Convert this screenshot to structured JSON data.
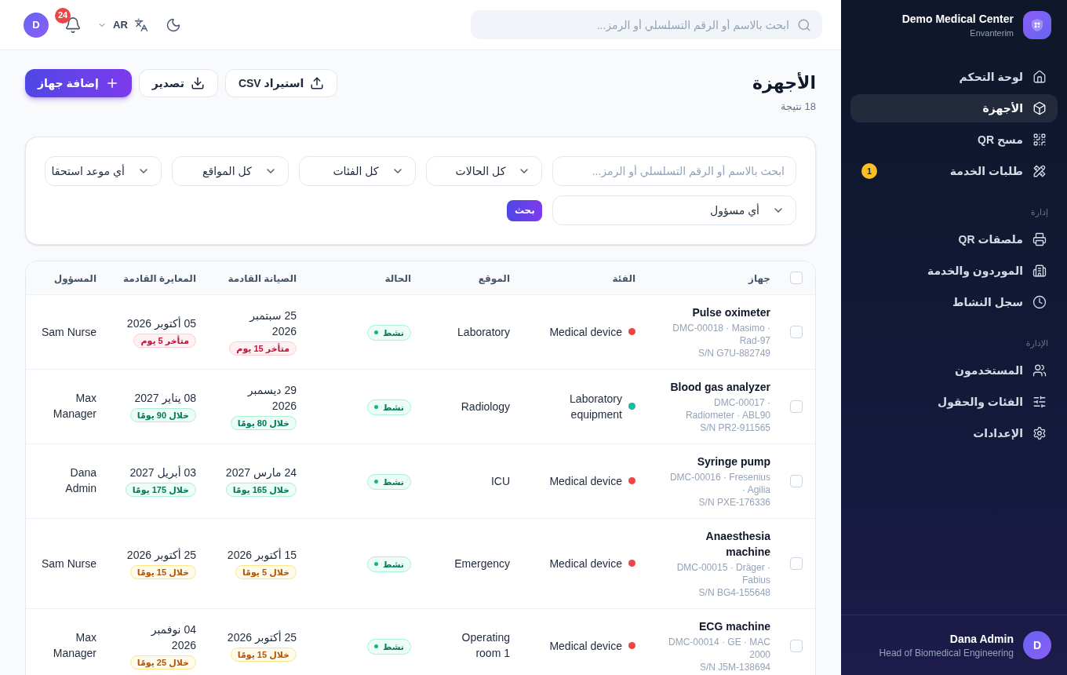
{
  "sidebar": {
    "brand": {
      "name": "Demo Medical Center",
      "subtitle": "Envanterim"
    },
    "sections": [
      {
        "items": [
          {
            "label": "لوحة التحكم",
            "selected": false
          },
          {
            "label": "الأجهزة",
            "selected": true
          },
          {
            "label": "مسح QR",
            "selected": false
          },
          {
            "label": "طلبات الخدمة",
            "selected": false,
            "badge": "1"
          }
        ]
      },
      {
        "heading": "إدارة",
        "items": [
          {
            "label": "ملصقات QR",
            "selected": false
          },
          {
            "label": "الموردون والخدمة",
            "selected": false
          },
          {
            "label": "سجل النشاط",
            "selected": false
          }
        ]
      },
      {
        "heading": "الإدارة",
        "items": [
          {
            "label": "المستخدمون",
            "selected": false
          },
          {
            "label": "الفئات والحقول",
            "selected": false
          },
          {
            "label": "الإعدادات",
            "selected": false
          }
        ]
      }
    ],
    "user": {
      "initial": "D",
      "name": "Dana Admin",
      "role": "Head of Biomedical Engineering"
    }
  },
  "top_bar": {
    "search": {
      "placeholder": "ابحث بالاسم أو الرقم التسلسلي أو الرمز..."
    },
    "language": "AR",
    "notifications": "24",
    "avatar": "D"
  },
  "page": {
    "title": "الأجهزة",
    "result_count": "18 نتيجة",
    "actions": [
      {
        "label": "استيراد CSV",
        "kind": "import"
      },
      {
        "label": "تصدير",
        "kind": "export"
      },
      {
        "label": "إضافة جهاز",
        "kind": "add"
      }
    ]
  },
  "filters": {
    "search": {
      "placeholder": "ابحث بالاسم أو الرقم التسلسلي أو الرمز..."
    },
    "selects": [
      "كل الحالات",
      "كل الفئات",
      "كل المواقع",
      "أي موعد استحقا",
      "أي مسؤول"
    ],
    "submit": "بحث"
  },
  "table": {
    "select_all": {
      "checked": false
    },
    "columns": [
      "جهاز",
      "الفئة",
      "الموقع",
      "الحالة",
      "الصيانة القادمة",
      "المعايرة القادمة",
      "المسؤول"
    ],
    "rows": [
      {
        "checked": false,
        "device": {
          "name": "Pulse oximeter",
          "details": "DMC-00018 · Masimo · Rad-97",
          "serial": "S/N G7U-882749"
        },
        "category": {
          "label": "Medical device",
          "color": "#ef4444"
        },
        "location": "Laboratory",
        "status": {
          "label": "نشط",
          "kind": "active"
        },
        "maintenance": {
          "date": "25 سبتمبر 2026",
          "badge": "متأخر 15 يوم",
          "kind": "overdue"
        },
        "calibration": {
          "date": "05 أكتوبر 2026",
          "badge": "متأخر 5 يوم",
          "kind": "overdue"
        },
        "owner": "Sam Nurse"
      },
      {
        "checked": false,
        "device": {
          "name": "Blood gas analyzer",
          "details": "DMC-00017 · Radiometer · ABL90",
          "serial": "S/N PR2-911565"
        },
        "category": {
          "label": "Laboratory equipment",
          "color": "#14b8a6"
        },
        "location": "Radiology",
        "status": {
          "label": "نشط",
          "kind": "active"
        },
        "maintenance": {
          "date": "29 ديسمبر 2026",
          "badge": "خلال 80 يومًا",
          "kind": "ok"
        },
        "calibration": {
          "date": "08 يناير 2027",
          "badge": "خلال 90 يومًا",
          "kind": "ok"
        },
        "owner": "Max Manager"
      },
      {
        "checked": false,
        "device": {
          "name": "Syringe pump",
          "details": "DMC-00016 · Fresenius · Agilia",
          "serial": "S/N PXE-176336"
        },
        "category": {
          "label": "Medical device",
          "color": "#ef4444"
        },
        "location": "ICU",
        "status": {
          "label": "نشط",
          "kind": "active"
        },
        "maintenance": {
          "date": "24 مارس 2027",
          "badge": "خلال 165 يومًا",
          "kind": "ok"
        },
        "calibration": {
          "date": "03 أبريل 2027",
          "badge": "خلال 175 يومًا",
          "kind": "ok"
        },
        "owner": "Dana Admin"
      },
      {
        "checked": false,
        "device": {
          "name": "Anaesthesia machine",
          "details": "DMC-00015 · Dräger · Fabius",
          "serial": "S/N BG4-155648"
        },
        "category": {
          "label": "Medical device",
          "color": "#ef4444"
        },
        "location": "Emergency",
        "status": {
          "label": "نشط",
          "kind": "active"
        },
        "maintenance": {
          "date": "15 أكتوبر 2026",
          "badge": "خلال 5 يومًا",
          "kind": "soon"
        },
        "calibration": {
          "date": "25 أكتوبر 2026",
          "badge": "خلال 15 يومًا",
          "kind": "soon"
        },
        "owner": "Sam Nurse"
      },
      {
        "checked": false,
        "device": {
          "name": "ECG machine",
          "details": "DMC-00014 · GE · MAC 2000",
          "serial": "S/N J5M-138694"
        },
        "category": {
          "label": "Medical device",
          "color": "#ef4444"
        },
        "location": "Operating room 1",
        "status": {
          "label": "نشط",
          "kind": "active"
        },
        "maintenance": {
          "date": "25 أكتوبر 2026",
          "badge": "خلال 15 يومًا",
          "kind": "soon"
        },
        "calibration": {
          "date": "04 نوفمبر 2026",
          "badge": "خلال 25 يومًا",
          "kind": "soon"
        },
        "owner": "Max Manager"
      }
    ]
  }
}
